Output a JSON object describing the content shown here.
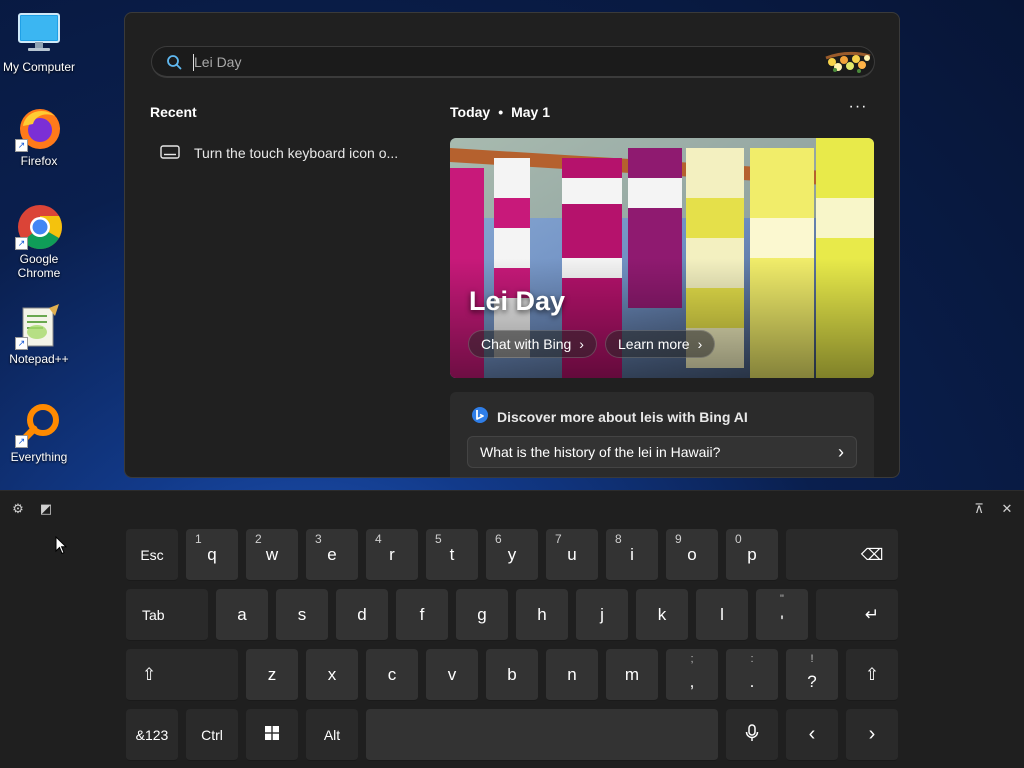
{
  "desktop": {
    "icons": [
      {
        "label": "My Computer",
        "icon": "monitor-icon"
      },
      {
        "label": "Firefox",
        "icon": "firefox-icon"
      },
      {
        "label": "Google Chrome",
        "icon": "chrome-icon"
      },
      {
        "label": "Notepad++",
        "icon": "notepadpp-icon"
      },
      {
        "label": "Everything",
        "icon": "everything-icon"
      }
    ]
  },
  "search_panel": {
    "search_placeholder": "Lei Day",
    "recent": {
      "title": "Recent",
      "items": [
        {
          "label": "Turn the touch keyboard icon o...",
          "icon": "keyboard-icon"
        }
      ]
    },
    "today": {
      "label": "Today",
      "separator": "•",
      "date": "May 1",
      "more": "···"
    },
    "hero": {
      "title": "Lei Day",
      "buttons": [
        {
          "label": "Chat with Bing",
          "chevron": "›"
        },
        {
          "label": "Learn more",
          "chevron": "›"
        }
      ]
    },
    "discover": {
      "title": "Discover more about leis with Bing AI",
      "question": "What is the history of the lei in Hawaii?",
      "chevron": "›"
    }
  },
  "keyboard": {
    "top_left": [
      {
        "name": "settings-icon",
        "glyph": "⚙"
      },
      {
        "name": "sticker-icon",
        "glyph": "◩"
      }
    ],
    "top_right": [
      {
        "name": "dock-icon",
        "glyph": "⊼"
      },
      {
        "name": "close-icon",
        "glyph": "✕"
      }
    ],
    "row1": {
      "esc": "Esc",
      "letters": [
        "q",
        "w",
        "e",
        "r",
        "t",
        "y",
        "u",
        "i",
        "o",
        "p"
      ],
      "numbers": [
        "1",
        "2",
        "3",
        "4",
        "5",
        "6",
        "7",
        "8",
        "9",
        "0"
      ],
      "backspace": "⌫"
    },
    "row2": {
      "tab": "Tab",
      "letters": [
        "a",
        "s",
        "d",
        "f",
        "g",
        "h",
        "j",
        "k",
        "l"
      ],
      "apostrophe": {
        "main": "'",
        "sub": "\""
      },
      "enter": "↵"
    },
    "row3": {
      "shift": "⇧",
      "letters": [
        "z",
        "x",
        "c",
        "v",
        "b",
        "n",
        "m"
      ],
      "comma": {
        "main": ",",
        "sub": ";"
      },
      "period": {
        "main": ".",
        "sub": ":"
      },
      "question": {
        "main": "?",
        "sub": "!"
      }
    },
    "row4": {
      "symbols": "&123",
      "ctrl": "Ctrl",
      "alt": "Alt",
      "space": "",
      "left": "‹",
      "right": "›"
    }
  }
}
